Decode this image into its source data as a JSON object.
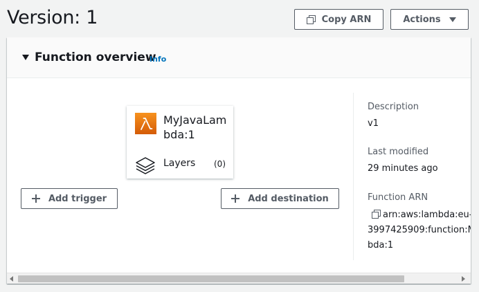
{
  "header": {
    "title": "Version: 1",
    "copy_arn_label": "Copy ARN",
    "actions_label": "Actions"
  },
  "overview": {
    "title": "Function overview",
    "info_label": "Info"
  },
  "function_card": {
    "name": "MyJavaLambda:1",
    "layers_label": "Layers",
    "layers_count": "(0)"
  },
  "diagram": {
    "add_trigger_label": "Add trigger",
    "add_destination_label": "Add destination"
  },
  "details": {
    "description_label": "Description",
    "description_value": "v1",
    "last_modified_label": "Last modified",
    "last_modified_value": "29 minutes ago",
    "arn_label": "Function ARN",
    "arn_line1": "arn:aws:lambda:eu-",
    "arn_line2": "3997425909:function:M",
    "arn_line3": "bda:1"
  },
  "colors": {
    "accent_link": "#0073bb",
    "lambda_orange": "#e8700f",
    "text_primary": "#16191f",
    "text_secondary": "#545b64"
  },
  "icons": {
    "copy": "copy-icon",
    "caret": "caret-down-icon",
    "lambda": "lambda-icon",
    "layers": "layers-icon",
    "plus": "plus-icon"
  }
}
